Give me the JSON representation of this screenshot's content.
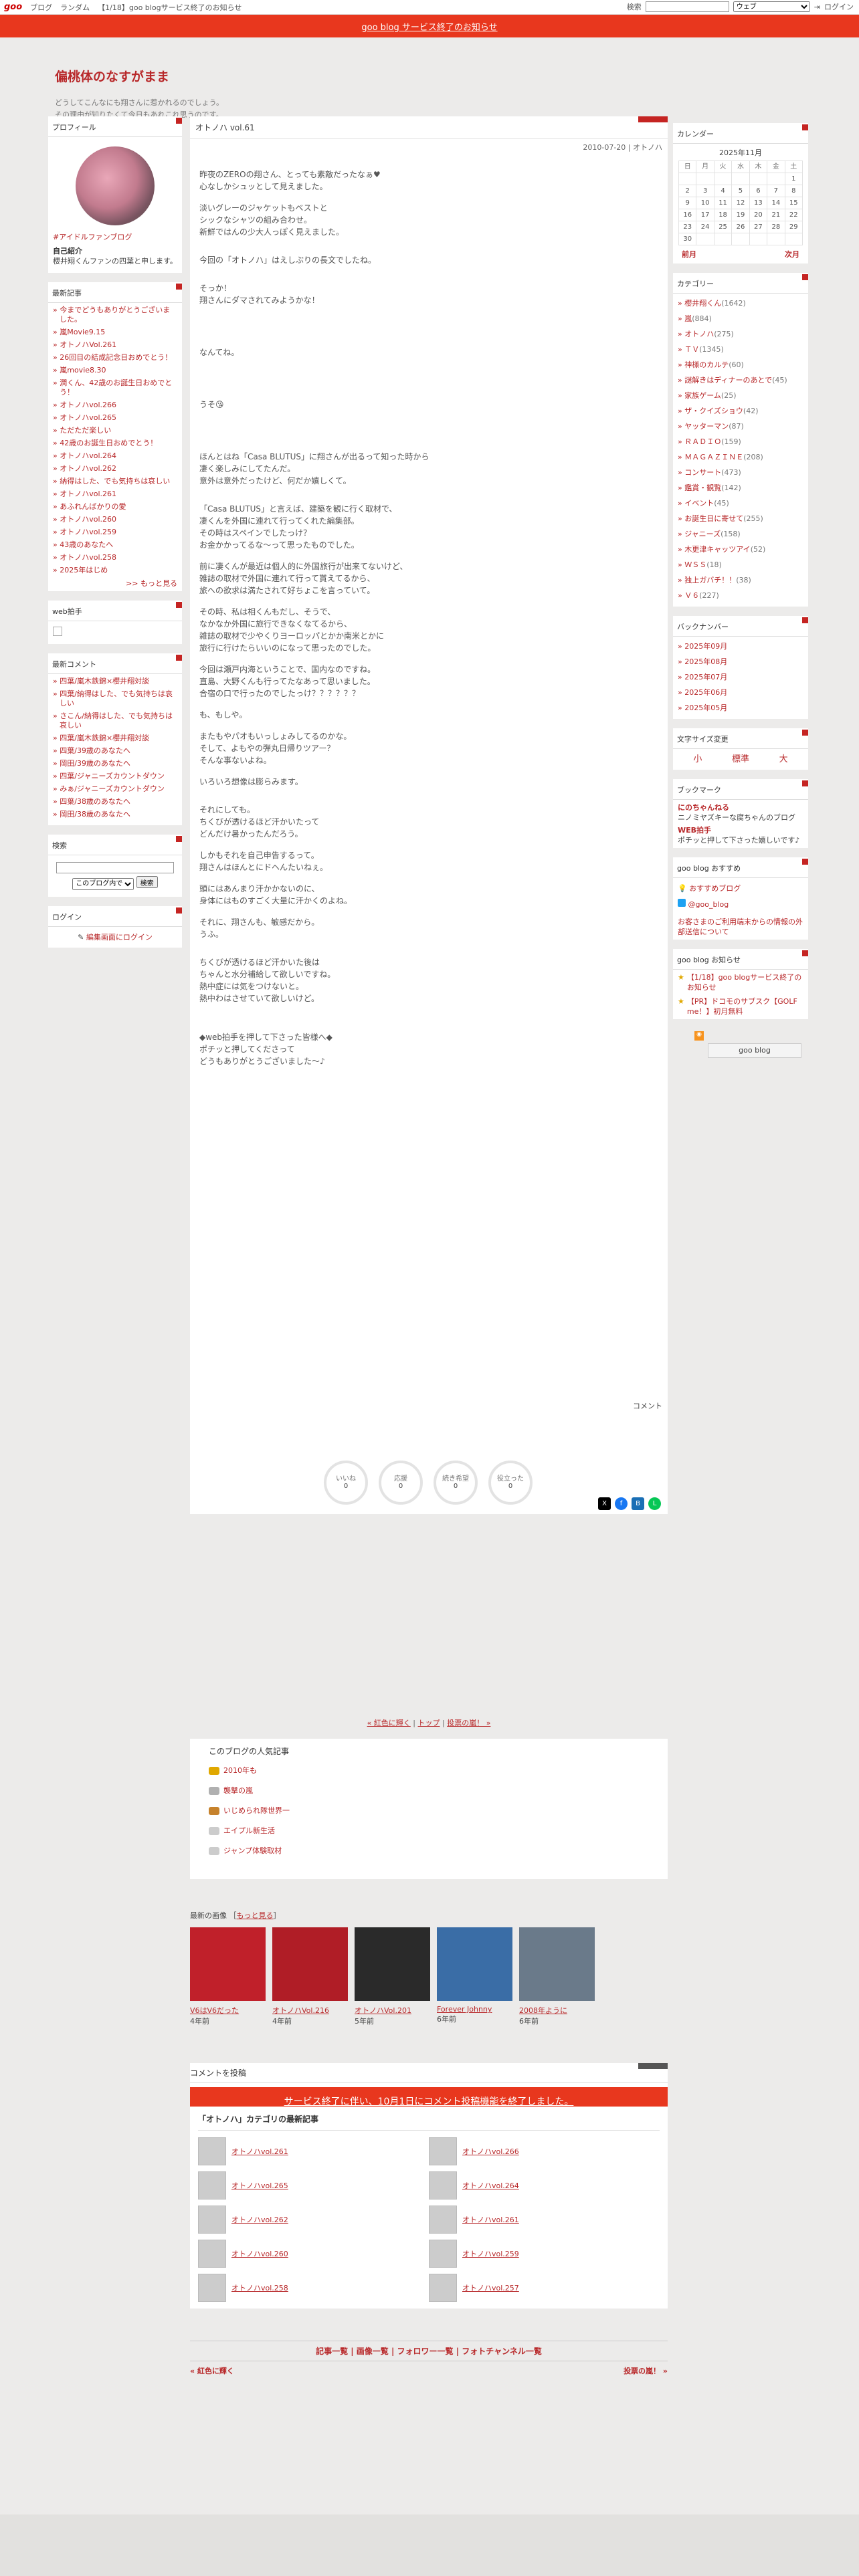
{
  "topbar": {
    "logo": "goo",
    "links": [
      "ブログ",
      "ランダム",
      "【1/18】goo blogサービス終了のお知らせ"
    ],
    "search_label": "検索",
    "select": "ウェブ",
    "login": "ログイン"
  },
  "notice": "goo blog サービス終了のお知らせ",
  "blog": {
    "title": "偏桃体のなすがまま",
    "desc1": "どうしてこんなにも翔さんに惹かれるのでしょう。",
    "desc2": "その理由が知りたくて今日もあれこれ思うのです。"
  },
  "profile": {
    "heading": "プロフィール",
    "fan": "#アイドルファンブログ",
    "intro_label": "自己紹介",
    "intro": "櫻井翔くんファンの四葉と申します。"
  },
  "recent": {
    "heading": "最新記事",
    "items": [
      "今までどうもありがとうございました。",
      "嵐Movie9.15",
      "オトノハVol.261",
      "26回目の結成記念日おめでとう！",
      "嵐movie8.30",
      "潤くん、42歳のお誕生日おめでとう！",
      "オトノハvol.266",
      "オトノハvol.265",
      "ただただ楽しい",
      "42歳のお誕生日おめでとう！",
      "オトノハvol.264",
      "オトノハvol.262",
      "納得はした、でも気持ちは哀しい",
      "オトノハvol.261",
      "あふれんばかりの愛",
      "オトノハvol.260",
      "オトノハvol.259",
      "43歳のあなたへ",
      "オトノハvol.258",
      "2025年はじめ"
    ],
    "more": ">> もっと見る"
  },
  "webclap": {
    "heading": "web拍手"
  },
  "comments": {
    "heading": "最新コメント",
    "items": [
      "四葉/嵐木鉄錦×櫻井翔対談",
      "四葉/納得はした、でも気持ちは哀しい",
      "さこん/納得はした、でも気持ちは哀しい",
      "四葉/嵐木鉄錦×櫻井翔対談",
      "四葉/39歳のあなたへ",
      "岡田/39歳のあなたへ",
      "四葉/ジャニーズカウントダウン",
      "みぁ/ジャニーズカウントダウン",
      "四葉/38歳のあなたへ",
      "岡田/38歳のあなたへ"
    ]
  },
  "search": {
    "heading": "検索",
    "select": "このブログ内で",
    "button": "検索"
  },
  "login": {
    "heading": "ログイン",
    "link": "編集画面にログイン"
  },
  "article": {
    "title": "オトノハ vol.61",
    "meta": "2010-07-20 | オトノハ",
    "body": [
      "昨夜のZEROの翔さん、とっても素敵だったなぁ♥\n心なしかシュッとして見えました。",
      "淡いグレーのジャケットもベストと\nシックなシャツの組み合わせ。\n新鮮ではんの少大人っぽく見えました。",
      "今回の「オトノハ」はえしぶりの長文でしたね。",
      "そっか！\n翔さんにダマされてみようかな！",
      "なんてね。",
      "うそ😘",
      "ほんとはね「Casa BLUTUS」に翔さんが出るって知った時から\n凄く楽しみにしてたんだ。\n意外は意外だったけど、何だか嬉しくて。",
      "「Casa BLUTUS」と言えば、建築を観に行く取材で、\n凄くんを外国に連れて行ってくれた編集部。\nその時はスペインでしたっけ？\nお金かかってるな～って思ったものでした。",
      "前に凄くんが最近は個人的に外国旅行が出来てないけど、\n雑誌の取材で外国に連れて行って貰えてるから、\n旅への欲求は満たされて好ちょこを言っていて。",
      "その時、私は相くんもだし、そうで、\nなかなか外国に旅行できなくなてるから、\n雑誌の取材で少やくりヨーロッパとかか南米とかに\n旅行に行けたらいいのになって思ったのでした。",
      "今回は瀬戸内海ということで、国内なのですね。\n直島、大野くんも行ってたなあって思いました。\n合宿の口で行ったのでしたっけ？？？？？？",
      "も、もしや。",
      "またもやパオもいっしょみしてるのかな。\nそして、よもやの弾丸日帰りツアー？\nそんな事ないよね。",
      "いろいろ想像は膨らみます。",
      "それにしても。\nちくびが透けるほど汗かいたって\nどんだけ暑かったんだろう。",
      "しかもそれを自己申告するって。\n翔さんはほんとにドヘんたいねぇ。",
      "頭にはあんまり汗かかないのに、\n身体にはものすごく大量に汗かくのよね。",
      "それに、翔さんも、敏感だから。\nうふ。",
      "ちくびが透けるほど汗かいた後は\nちゃんと水分補給して欲しいですね。\n熱中症には気をつけないと。\n熱中わはさせていて欲しいけど。",
      "◆web拍手を押して下さった皆様へ◆\nポチッと押してくださって\nどうもありがとうございました～♪"
    ],
    "comment": "コメント",
    "reactions": [
      {
        "label": "いいね",
        "n": "0"
      },
      {
        "label": "応援",
        "n": "0"
      },
      {
        "label": "続き希望",
        "n": "0"
      },
      {
        "label": "役立った",
        "n": "0"
      }
    ]
  },
  "calendar": {
    "heading": "カレンダー",
    "month": "2025年11月",
    "days": [
      "日",
      "月",
      "火",
      "水",
      "木",
      "金",
      "土"
    ],
    "rows": [
      [
        "",
        "",
        "",
        "",
        "",
        "",
        "1"
      ],
      [
        "2",
        "3",
        "4",
        "5",
        "6",
        "7",
        "8"
      ],
      [
        "9",
        "10",
        "11",
        "12",
        "13",
        "14",
        "15"
      ],
      [
        "16",
        "17",
        "18",
        "19",
        "20",
        "21",
        "22"
      ],
      [
        "23",
        "24",
        "25",
        "26",
        "27",
        "28",
        "29"
      ],
      [
        "30",
        "",
        "",
        "",
        "",
        "",
        ""
      ]
    ],
    "prev": "前月",
    "next": "次月"
  },
  "categories": {
    "heading": "カテゴリー",
    "items": [
      [
        "櫻井翔くん",
        "(1642)"
      ],
      [
        "嵐",
        "(884)"
      ],
      [
        "オトノハ",
        "(275)"
      ],
      [
        "ＴＶ",
        "(1345)"
      ],
      [
        "神様のカルテ",
        "(60)"
      ],
      [
        "謎解きはディナーのあとで",
        "(45)"
      ],
      [
        "家族ゲーム",
        "(25)"
      ],
      [
        "ザ・クイズショウ",
        "(42)"
      ],
      [
        "ヤッターマン",
        "(87)"
      ],
      [
        "ＲＡＤＩＯ",
        "(159)"
      ],
      [
        "ＭＡＧＡＺＩＮＥ",
        "(208)"
      ],
      [
        "コンサート",
        "(473)"
      ],
      [
        "鑑賞・観覧",
        "(142)"
      ],
      [
        "イベント",
        "(45)"
      ],
      [
        "お誕生日に寄せて",
        "(255)"
      ],
      [
        "ジャニーズ",
        "(158)"
      ],
      [
        "木更津キャッツアイ",
        "(52)"
      ],
      [
        "ＷＳＳ",
        "(18)"
      ],
      [
        "独上ガバチ！！",
        "(38)"
      ],
      [
        "Ｖ６",
        "(227)"
      ]
    ]
  },
  "backnumber": {
    "heading": "バックナンバー",
    "items": [
      "2025年09月",
      "2025年08月",
      "2025年07月",
      "2025年06月",
      "2025年05月"
    ]
  },
  "fontsize": {
    "heading": "文字サイズ変更",
    "small": "小",
    "normal": "標準",
    "large": "大"
  },
  "bookmark": {
    "heading": "ブックマーク",
    "l1": "にのちゃんねる",
    "d1": "ニノミヤズキーな腐ちゃんのブログ",
    "l2": "WEB拍手",
    "d2": "ポチッと押して下さった嬉しいです♪"
  },
  "recommend": {
    "heading": "goo blog おすすめ",
    "i1": "おすすめブログ",
    "i2": "@goo_blog",
    "i3": "お客さまのご利用端末からの情報の外部送信について"
  },
  "info": {
    "heading": "goo blog お知らせ",
    "i1": "【1/18】goo blogサービス終了のお知らせ",
    "i2": "【PR】ドコモのサブスク【GOLF me！】初月無料"
  },
  "gooblog_badge": "goo blog",
  "pager": {
    "prev": "« 紅色に輝く",
    "top": "トップ",
    "next": "投票の嵐！ »"
  },
  "popular": {
    "heading": "このブログの人気記事",
    "items": [
      "2010年も",
      "襲撃の嵐",
      "いじめられ隊世界一",
      "エイプル新生活",
      "ジャンプ体験取材"
    ]
  },
  "latest_images": {
    "heading": "最新の画像",
    "more": "もっと見る",
    "items": [
      [
        "V6はV6だった",
        "4年前"
      ],
      [
        "オトノハVol.216",
        "4年前"
      ],
      [
        "オトノハVol.201",
        "5年前"
      ],
      [
        "Forever Johnny",
        "6年前"
      ],
      [
        "2008年ように",
        "6年前"
      ]
    ]
  },
  "cform": {
    "heading": "コメントを投稿",
    "stop": "サービス終了に伴い、10月1日にコメント投稿機能を終了しました。"
  },
  "catlist": {
    "heading": "「オトノハ」カテゴリの最新記事",
    "items": [
      "オトノハvol.261",
      "オトノハvol.266",
      "オトノハvol.265",
      "オトノハvol.264",
      "オトノハvol.262",
      "オトノハvol.261",
      "オトノハvol.260",
      "オトノハvol.259",
      "オトノハvol.258",
      "オトノハvol.257"
    ]
  },
  "footer": {
    "links": "記事一覧 | 画像一覧 | フォロワー一覧 | フォトチャンネル一覧",
    "prev": "« 紅色に輝く",
    "next": "投票の嵐！ »"
  }
}
